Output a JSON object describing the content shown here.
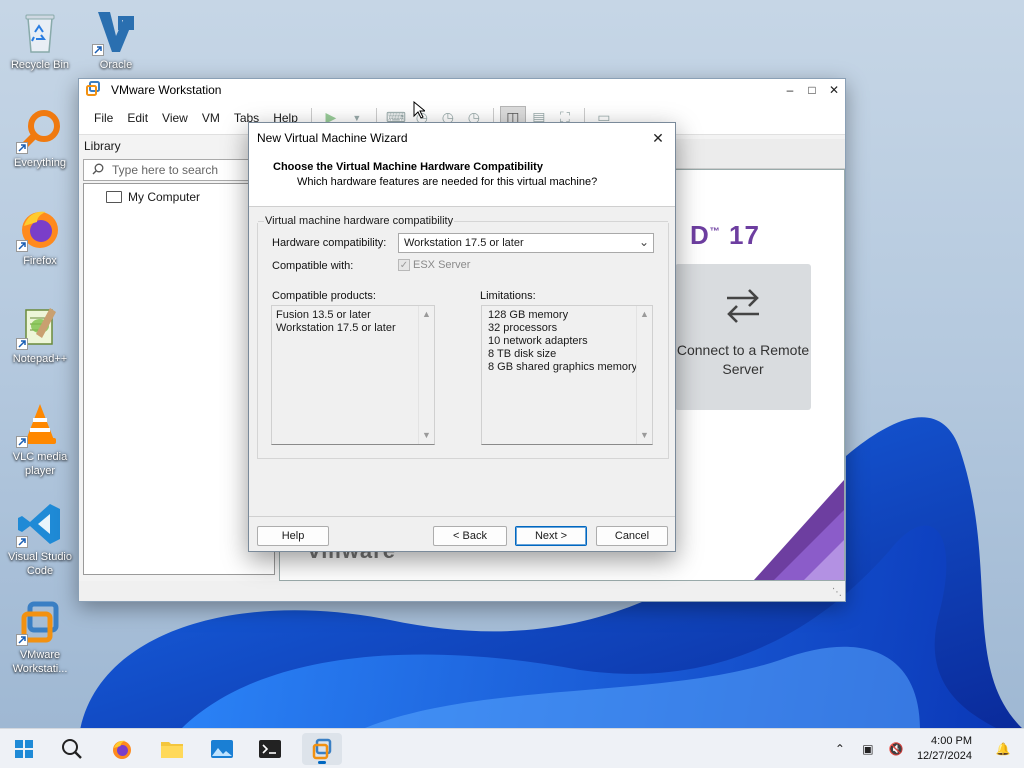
{
  "desktop": {
    "icons": [
      {
        "label": "Recycle Bin",
        "icon": "recycle-bin-icon"
      },
      {
        "label": "Oracle",
        "icon": "virtualbox-icon"
      },
      {
        "label": "Everything",
        "icon": "magnifier-icon"
      },
      {
        "label": "Firefox",
        "icon": "firefox-icon"
      },
      {
        "label": "Notepad++",
        "icon": "notepadpp-icon"
      },
      {
        "label": "VLC media player",
        "icon": "vlc-icon"
      },
      {
        "label": "Visual Studio Code",
        "icon": "vscode-icon"
      },
      {
        "label": "VMware Workstati...",
        "icon": "vmware-icon"
      }
    ]
  },
  "vmware": {
    "title": "VMware Workstation",
    "menu": [
      "File",
      "Edit",
      "View",
      "VM",
      "Tabs",
      "Help"
    ],
    "library": {
      "title": "Library",
      "search_placeholder": "Type here to search",
      "tree": [
        {
          "label": "My Computer"
        }
      ]
    },
    "home": {
      "version": "17",
      "remote_label": "Connect to a Remote Server",
      "wordmark": "vmware"
    }
  },
  "wizard": {
    "title": "New Virtual Machine Wizard",
    "heading": "Choose the Virtual Machine Hardware Compatibility",
    "subheading": "Which hardware features are needed for this virtual machine?",
    "group_label": "Virtual machine hardware compatibility",
    "hw_compat_label": "Hardware compatibility:",
    "hw_compat_value": "Workstation 17.5 or later",
    "compatible_with_label": "Compatible with:",
    "esx_label": "ESX Server",
    "esx_checked": true,
    "products_label": "Compatible products:",
    "products": [
      "Fusion 13.5 or later",
      "Workstation 17.5 or later"
    ],
    "limitations_label": "Limitations:",
    "limitations": [
      "128 GB memory",
      "32 processors",
      "10 network adapters",
      "8 TB disk size",
      "8 GB shared graphics memory"
    ],
    "buttons": {
      "help": "Help",
      "back": "< Back",
      "next": "Next >",
      "cancel": "Cancel"
    }
  },
  "taskbar": {
    "apps": [
      "start",
      "search",
      "firefox",
      "file-explorer",
      "photos",
      "terminal",
      "vmware"
    ],
    "active_app": "vmware",
    "time": "4:00 PM",
    "date": "12/27/2024"
  },
  "colors": {
    "accent": "#0067c0",
    "vmware_purple": "#6d3ea0"
  }
}
